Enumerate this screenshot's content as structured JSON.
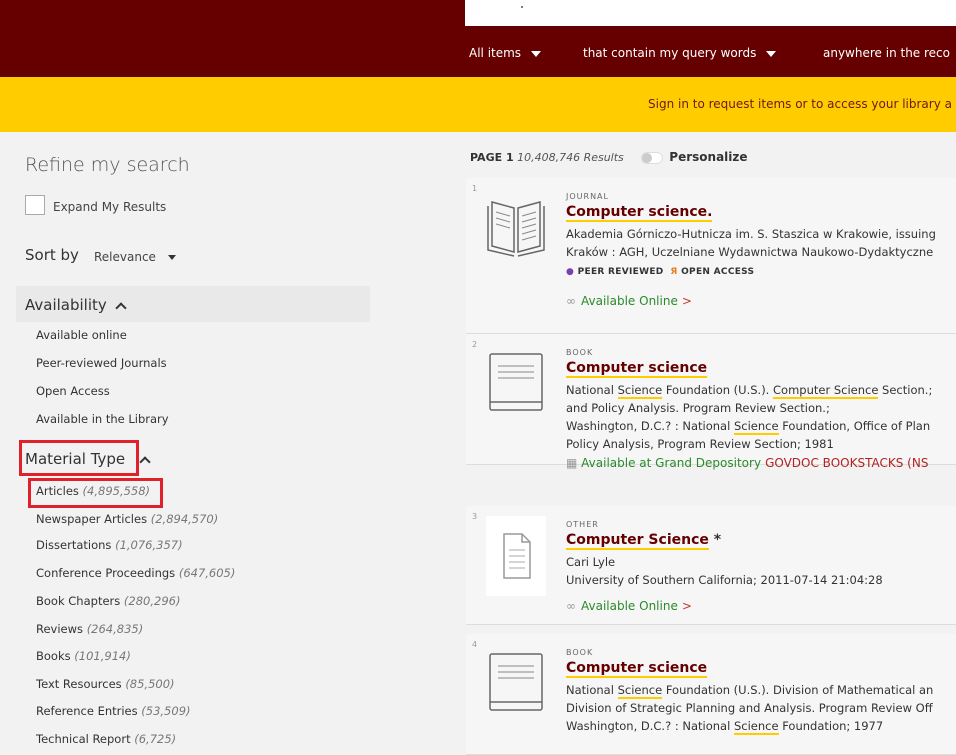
{
  "header": {
    "search_dot": ".",
    "scope_items": "All items",
    "scope_match": "that contain my query words",
    "scope_field": "anywhere in the reco"
  },
  "banner": {
    "text": "Sign in to request items or to access your library a"
  },
  "sidebar": {
    "refine_title": "Refine my search",
    "expand_label": "Expand My Results",
    "sort_label": "Sort by",
    "sort_value": "Relevance",
    "availability_title": "Availability",
    "availability_items": [
      "Available online",
      "Peer-reviewed Journals",
      "Open Access",
      "Available in the Library"
    ],
    "material_type_title": "Material Type",
    "material_types": [
      {
        "label": "Articles",
        "count": "(4,895,558)"
      },
      {
        "label": "Newspaper Articles",
        "count": "(2,894,570)"
      },
      {
        "label": "Dissertations",
        "count": "(1,076,357)"
      },
      {
        "label": "Conference Proceedings",
        "count": "(647,605)"
      },
      {
        "label": "Book Chapters",
        "count": "(280,296)"
      },
      {
        "label": "Reviews",
        "count": "(264,835)"
      },
      {
        "label": "Books",
        "count": "(101,914)"
      },
      {
        "label": "Text Resources",
        "count": "(85,500)"
      },
      {
        "label": "Reference Entries",
        "count": "(53,509)"
      },
      {
        "label": "Technical Report",
        "count": "(6,725)"
      }
    ]
  },
  "results": {
    "page_label": "PAGE 1",
    "count": "10,408,746 Results",
    "personalize": "Personalize",
    "items": [
      {
        "num": "1",
        "type": "JOURNAL",
        "title": "Computer science.",
        "line1": "Akademia Górniczo-Hutnicza im. S. Staszica w Krakowie, issuing",
        "line2": "Kraków : AGH, Uczelniane Wydawnictwa Naukowo-Dydaktyczne",
        "peer": "PEER REVIEWED",
        "open": "OPEN ACCESS",
        "availability": "Available Online",
        "arrow": ">"
      },
      {
        "num": "2",
        "type": "BOOK",
        "title": "Computer science",
        "line1a": "National ",
        "line1b": "Science",
        "line1c": " Foundation (U.S.). ",
        "line1d": "Computer Science",
        "line1e": " Section.;",
        "line2": "and Policy Analysis. Program Review Section.;",
        "line3a": "Washington, D.C.? : National ",
        "line3b": "Science",
        "line3c": " Foundation, Office of Plan",
        "line4": "Policy Analysis, Program Review Section; 1981",
        "availability": "Available at Grand Depository",
        "location": "GOVDOC BOOKSTACKS (NS"
      },
      {
        "num": "3",
        "type": "OTHER",
        "title": "Computer Science",
        "star": "*",
        "line1": "Cari Lyle",
        "line2": "University of Southern California; 2011-07-14 21:04:28",
        "availability": "Available Online",
        "arrow": ">"
      },
      {
        "num": "4",
        "type": "BOOK",
        "title": "Computer science",
        "line1a": "National ",
        "line1b": "Science",
        "line1c": " Foundation (U.S.). Division of Mathematical an",
        "line2": "Division of Strategic Planning and Analysis. Program Review Off",
        "line3a": "Washington, D.C.? : National ",
        "line3b": "Science",
        "line3c": " Foundation; 1977"
      }
    ]
  },
  "colors": {
    "header": "#660000",
    "banner": "#ffcc00",
    "highlight": "#e0202a",
    "available": "#2a8a2a"
  }
}
